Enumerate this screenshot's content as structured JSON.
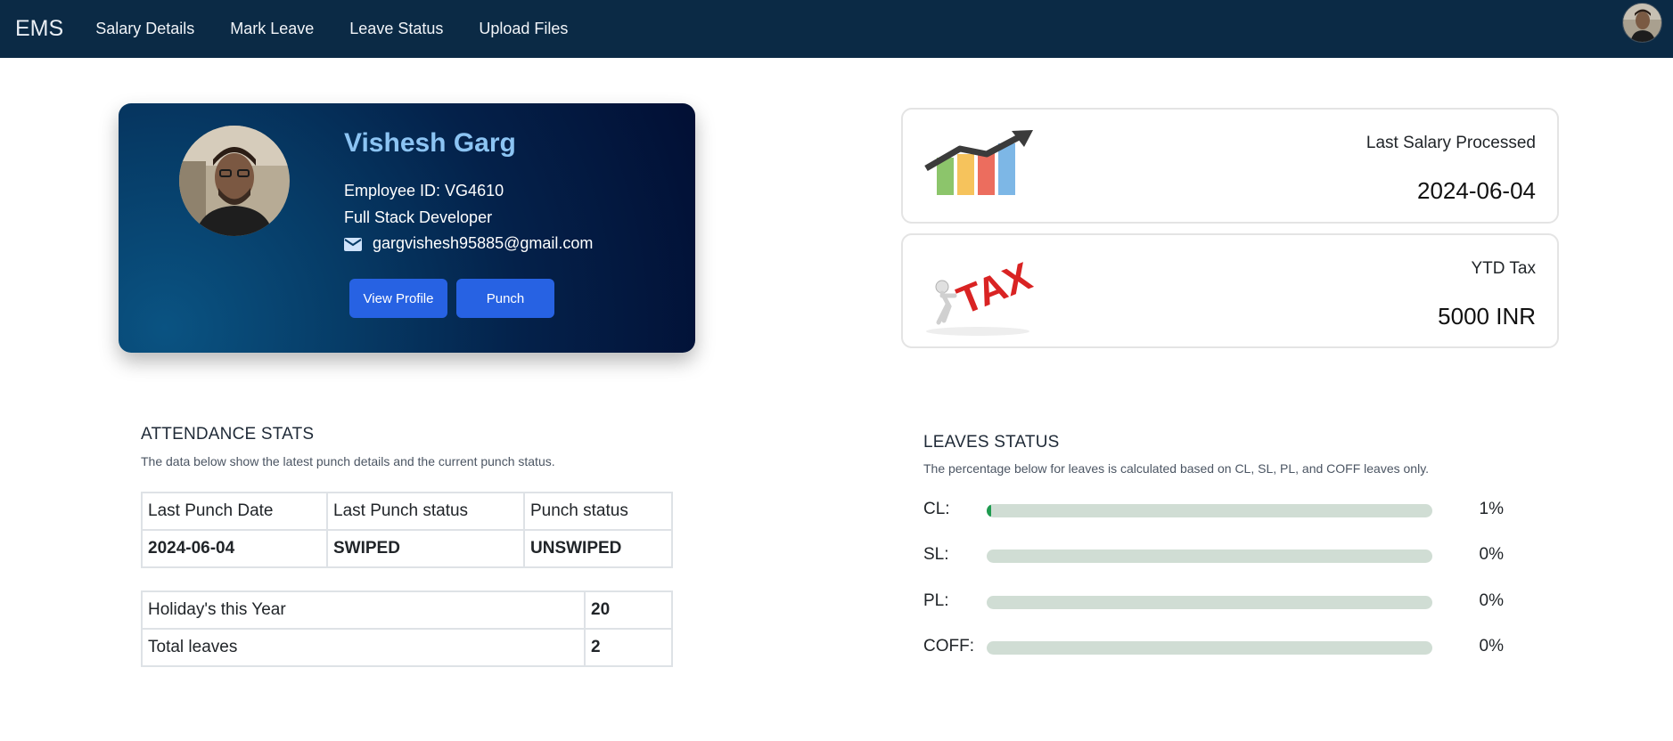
{
  "navbar": {
    "brand": "EMS",
    "links": [
      "Salary Details",
      "Mark Leave",
      "Leave Status",
      "Upload Files"
    ]
  },
  "profile": {
    "name": "Vishesh Garg",
    "employee_id": "Employee ID: VG4610",
    "role": "Full Stack Developer",
    "email": "gargvishesh95885@gmail.com",
    "view_profile_label": "View Profile",
    "punch_label": "Punch"
  },
  "salary_card": {
    "label": "Last Salary Processed",
    "value": "2024-06-04",
    "icon": "growth-chart-icon"
  },
  "tax_card": {
    "label": "YTD Tax",
    "value": "5000 INR",
    "icon": "tax-figure-icon",
    "image_text": "TAX"
  },
  "attendance": {
    "title": "ATTENDANCE STATS",
    "subtitle": "The data below show the latest punch details and the current punch status.",
    "headers": [
      "Last Punch Date",
      "Last Punch status",
      "Punch status"
    ],
    "row": [
      "2024-06-04",
      "SWIPED",
      "UNSWIPED"
    ],
    "summary": [
      {
        "label": "Holiday's this Year",
        "value": "20"
      },
      {
        "label": "Total leaves",
        "value": "2"
      }
    ]
  },
  "leaves": {
    "title": "LEAVES STATUS",
    "subtitle": "The percentage below for leaves is calculated based on CL, SL, PL, and COFF leaves only.",
    "items": [
      {
        "label": "CL:",
        "percent_text": "1%",
        "percent": 1
      },
      {
        "label": "SL:",
        "percent_text": "0%",
        "percent": 0
      },
      {
        "label": "PL:",
        "percent_text": "0%",
        "percent": 0
      },
      {
        "label": "COFF:",
        "percent_text": "0%",
        "percent": 0
      }
    ]
  },
  "colors": {
    "navbar": "#0b2a45",
    "button": "#2762e3",
    "name": "#8cc4f3",
    "progress_fill": "#1e9b4f",
    "progress_track": "#d0ddd4"
  }
}
